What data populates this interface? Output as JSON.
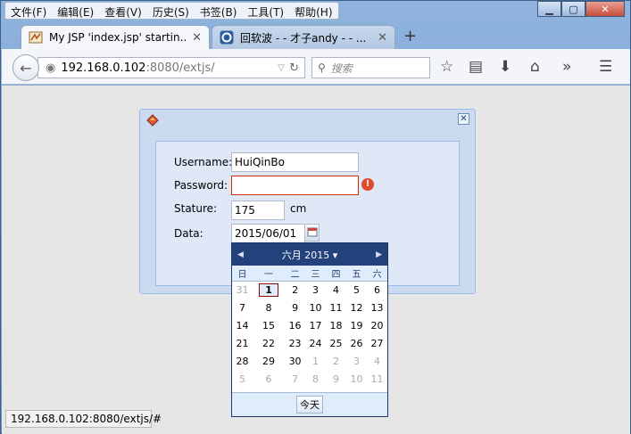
{
  "menu": [
    "文件(F)",
    "编辑(E)",
    "查看(V)",
    "历史(S)",
    "书签(B)",
    "工具(T)",
    "帮助(H)"
  ],
  "tabs": [
    {
      "title": "My JSP 'index.jsp' startin..."
    },
    {
      "title": "回软波 - - 才子andy - - ..."
    }
  ],
  "navbar": {
    "url_host": "192.168.0.102",
    "url_path": ":8080/extjs/",
    "search_placeholder": "搜索"
  },
  "form": {
    "username_label": "Username:",
    "username_value": "HuiQinBo",
    "password_label": "Password:",
    "password_value": "",
    "stature_label": "Stature:",
    "stature_value": "175",
    "stature_unit": "cm",
    "date_label": "Data:",
    "date_value": "2015/06/01"
  },
  "datepicker": {
    "month_label": "六月 2015",
    "weekdays": [
      "日",
      "一",
      "二",
      "三",
      "四",
      "五",
      "六"
    ],
    "weeks": [
      [
        "31",
        "1",
        "2",
        "3",
        "4",
        "5",
        "6"
      ],
      [
        "7",
        "8",
        "9",
        "10",
        "11",
        "12",
        "13"
      ],
      [
        "14",
        "15",
        "16",
        "17",
        "18",
        "19",
        "20"
      ],
      [
        "21",
        "22",
        "23",
        "24",
        "25",
        "26",
        "27"
      ],
      [
        "28",
        "29",
        "30",
        "1",
        "2",
        "3",
        "4"
      ],
      [
        "5",
        "6",
        "7",
        "8",
        "9",
        "10",
        "11"
      ]
    ],
    "other_month": [
      [
        true,
        false,
        false,
        false,
        false,
        false,
        false
      ],
      [
        false,
        false,
        false,
        false,
        false,
        false,
        false
      ],
      [
        false,
        false,
        false,
        false,
        false,
        false,
        false
      ],
      [
        false,
        false,
        false,
        false,
        false,
        false,
        false
      ],
      [
        false,
        false,
        false,
        true,
        true,
        true,
        true
      ],
      [
        true,
        true,
        true,
        true,
        true,
        true,
        true
      ]
    ],
    "selected": "1",
    "today_label": "今天"
  },
  "status_text": "192.168.0.102:8080/extjs/#",
  "colors": {
    "error": "#e04a2b",
    "picker_header": "#23427b"
  }
}
